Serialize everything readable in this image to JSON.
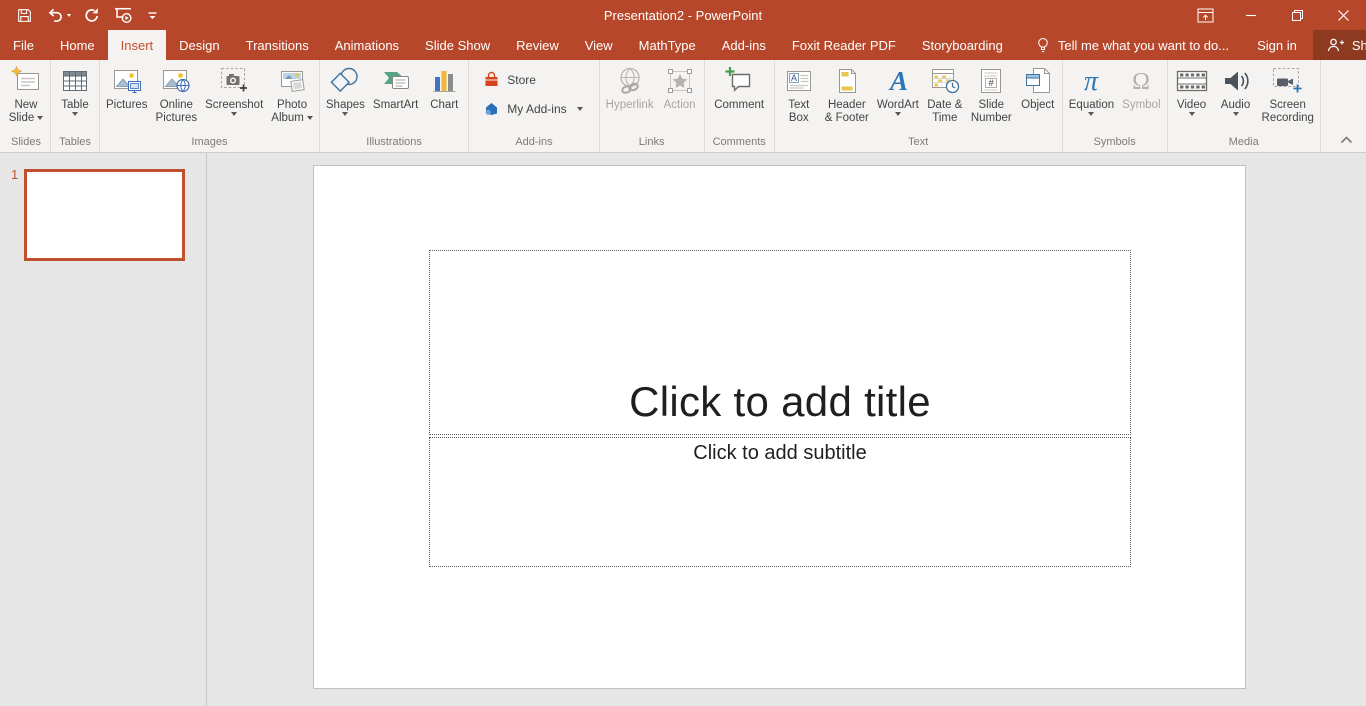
{
  "titlebar": {
    "title": "Presentation2 - PowerPoint",
    "qat": [
      {
        "name": "save-button",
        "icon": "save"
      },
      {
        "name": "undo-button",
        "icon": "undo",
        "caret": true
      },
      {
        "name": "redo-button",
        "icon": "redo"
      },
      {
        "name": "start-from-beginning-button",
        "icon": "start-from-beginning"
      },
      {
        "name": "customize-quick-access-toolbar-button",
        "icon": "qat-more"
      }
    ],
    "window_controls": [
      {
        "name": "ribbon-display-options-button",
        "icon": "ribbon-display-options"
      },
      {
        "name": "minimize-button",
        "icon": "minimize"
      },
      {
        "name": "restore-button",
        "icon": "restore"
      },
      {
        "name": "close-button",
        "icon": "close"
      }
    ]
  },
  "tabs": [
    {
      "label": "File"
    },
    {
      "label": "Home"
    },
    {
      "label": "Insert",
      "active": true
    },
    {
      "label": "Design"
    },
    {
      "label": "Transitions"
    },
    {
      "label": "Animations"
    },
    {
      "label": "Slide Show"
    },
    {
      "label": "Review"
    },
    {
      "label": "View"
    },
    {
      "label": "MathType"
    },
    {
      "label": "Add-ins"
    },
    {
      "label": "Foxit Reader PDF"
    },
    {
      "label": "Storyboarding"
    }
  ],
  "tellme": {
    "label": "Tell me what you want to do...",
    "icon": "lightbulb"
  },
  "account": {
    "sign_in": "Sign in",
    "share": "Share"
  },
  "ribbon": {
    "groups": [
      {
        "label": "Slides",
        "items": [
          {
            "name": "new-slide-button",
            "icon": "new-slide",
            "lines": [
              "New",
              "Slide"
            ],
            "caret": "inline"
          }
        ]
      },
      {
        "label": "Tables",
        "items": [
          {
            "name": "table-button",
            "icon": "table",
            "lines": [
              "Table"
            ],
            "caret": "below"
          }
        ]
      },
      {
        "label": "Images",
        "items": [
          {
            "name": "pictures-button",
            "icon": "pictures",
            "lines": [
              "Pictures"
            ]
          },
          {
            "name": "online-pictures-button",
            "icon": "online-pictures",
            "lines": [
              "Online",
              "Pictures"
            ]
          },
          {
            "name": "screenshot-button",
            "icon": "screenshot",
            "lines": [
              "Screenshot"
            ],
            "caret": "below"
          },
          {
            "name": "photo-album-button",
            "icon": "photo-album",
            "lines": [
              "Photo",
              "Album"
            ],
            "caret": "inline"
          }
        ]
      },
      {
        "label": "Illustrations",
        "items": [
          {
            "name": "shapes-button",
            "icon": "shapes",
            "lines": [
              "Shapes"
            ],
            "caret": "below"
          },
          {
            "name": "smartart-button",
            "icon": "smartart",
            "lines": [
              "SmartArt"
            ]
          },
          {
            "name": "chart-button",
            "icon": "chart",
            "lines": [
              "Chart"
            ]
          }
        ]
      },
      {
        "label": "Add-ins",
        "small": true,
        "items": [
          {
            "name": "store-button",
            "icon": "store",
            "label": "Store"
          },
          {
            "name": "my-add-ins-button",
            "icon": "my-addins",
            "label": "My Add-ins",
            "caret": true
          }
        ]
      },
      {
        "label": "Links",
        "items": [
          {
            "name": "hyperlink-button",
            "icon": "hyperlink",
            "lines": [
              "Hyperlink"
            ],
            "disabled": true
          },
          {
            "name": "action-button",
            "icon": "action",
            "lines": [
              "Action"
            ],
            "disabled": true
          }
        ]
      },
      {
        "label": "Comments",
        "items": [
          {
            "name": "comment-button",
            "icon": "comment",
            "lines": [
              "Comment"
            ]
          }
        ]
      },
      {
        "label": "Text",
        "items": [
          {
            "name": "text-box-button",
            "icon": "text-box",
            "lines": [
              "Text",
              "Box"
            ]
          },
          {
            "name": "header-footer-button",
            "icon": "header-footer",
            "lines": [
              "Header",
              "& Footer"
            ]
          },
          {
            "name": "wordart-button",
            "icon": "wordart",
            "lines": [
              "WordArt"
            ],
            "caret": "below"
          },
          {
            "name": "date-time-button",
            "icon": "date-time",
            "lines": [
              "Date &",
              "Time"
            ]
          },
          {
            "name": "slide-number-button",
            "icon": "slide-number",
            "lines": [
              "Slide",
              "Number"
            ]
          },
          {
            "name": "object-button",
            "icon": "object",
            "lines": [
              "Object"
            ]
          }
        ]
      },
      {
        "label": "Symbols",
        "items": [
          {
            "name": "equation-button",
            "icon": "equation",
            "lines": [
              "Equation"
            ],
            "caret": "below"
          },
          {
            "name": "symbol-button",
            "icon": "symbol",
            "lines": [
              "Symbol"
            ],
            "disabled": true
          }
        ]
      },
      {
        "label": "Media",
        "items": [
          {
            "name": "video-button",
            "icon": "video",
            "lines": [
              "Video"
            ],
            "caret": "below"
          },
          {
            "name": "audio-button",
            "icon": "audio",
            "lines": [
              "Audio"
            ],
            "caret": "below"
          },
          {
            "name": "screen-recording-button",
            "icon": "screen-recording",
            "lines": [
              "Screen",
              "Recording"
            ]
          }
        ]
      }
    ]
  },
  "slide_panel": {
    "slide_number": "1"
  },
  "slide": {
    "title_placeholder": "Click to add title",
    "subtitle_placeholder": "Click to add subtitle"
  },
  "colors": {
    "accent": "#B7472A",
    "share_button_bg": "#8E3A21",
    "active_tab_text": "#C0502E",
    "thumbnail_border": "#C1502E",
    "disabled_text": "#A8A6A4"
  }
}
